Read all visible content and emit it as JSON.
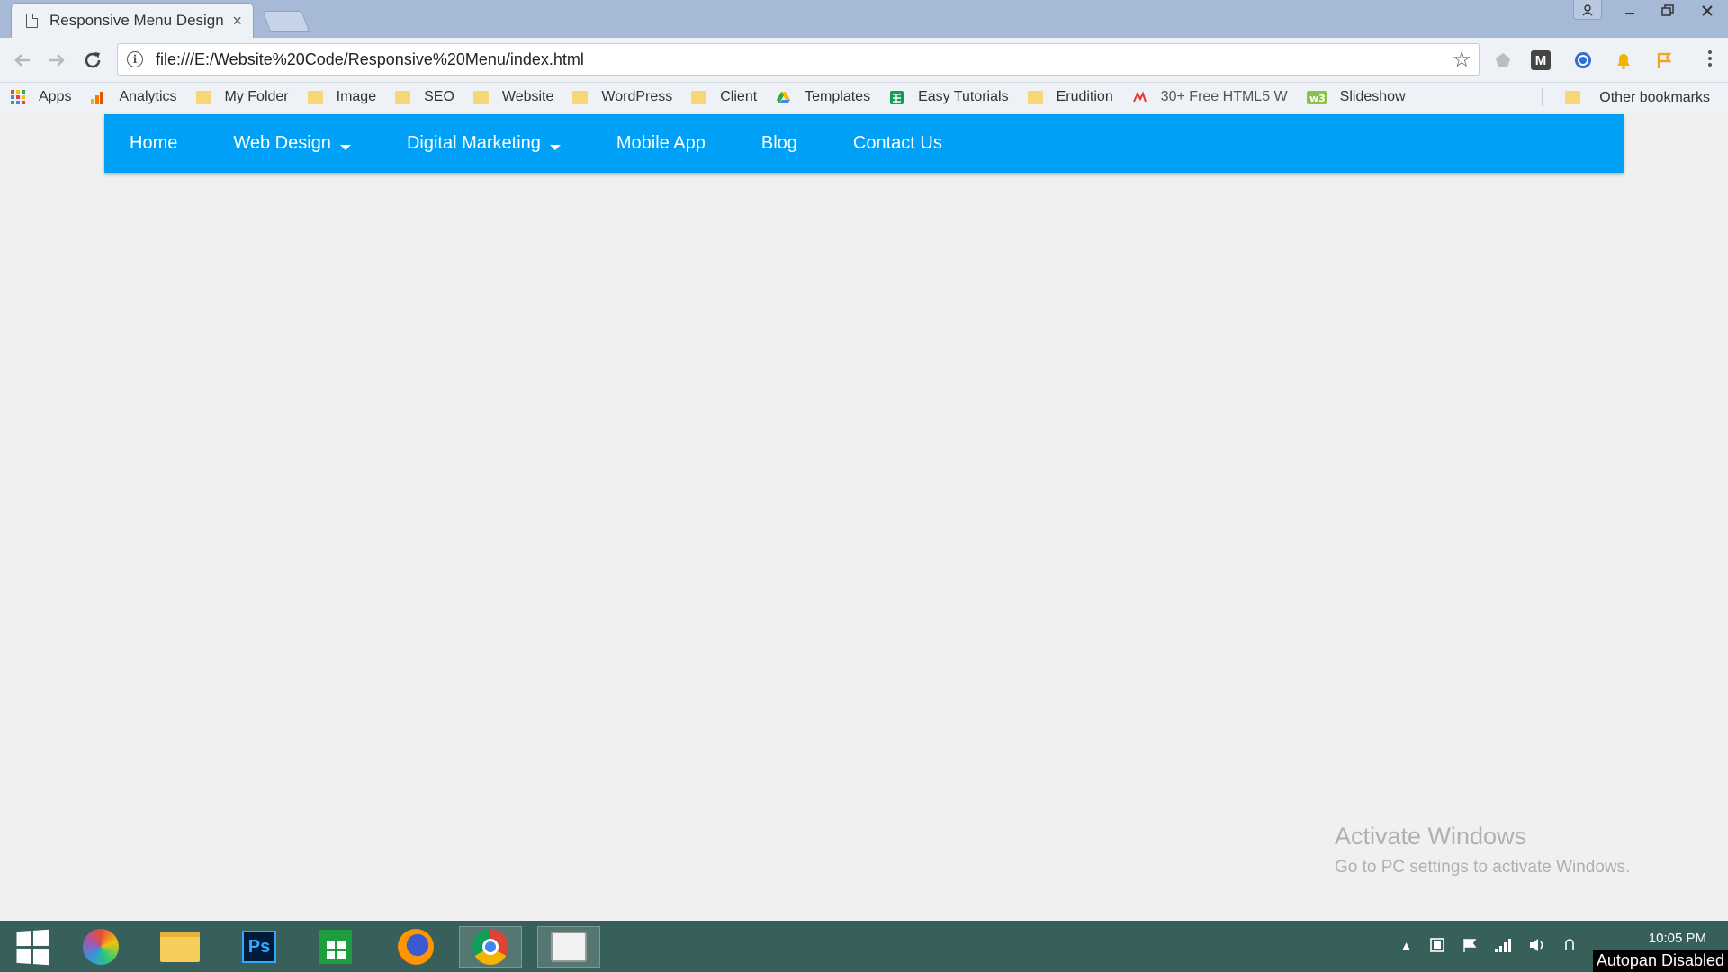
{
  "browser": {
    "tab_title": "Responsive Menu Design",
    "tab_close": "×",
    "url": "file:///E:/Website%20Code/Responsive%20Menu/index.html",
    "bookmarks": [
      {
        "label": "Apps",
        "icon": "apps-grid-icon"
      },
      {
        "label": "Analytics",
        "icon": "analytics-icon"
      },
      {
        "label": "My Folder",
        "icon": "folder-icon"
      },
      {
        "label": "Image",
        "icon": "folder-icon"
      },
      {
        "label": "SEO",
        "icon": "folder-icon"
      },
      {
        "label": "Website",
        "icon": "folder-icon"
      },
      {
        "label": "WordPress",
        "icon": "folder-icon"
      },
      {
        "label": "Client",
        "icon": "folder-icon"
      },
      {
        "label": "Templates",
        "icon": "drive-icon"
      },
      {
        "label": "Easy Tutorials",
        "icon": "sheets-icon"
      },
      {
        "label": "Erudition",
        "icon": "folder-icon"
      },
      {
        "label": "30+ Free HTML5 W",
        "icon": "html5-icon"
      },
      {
        "label": "Slideshow",
        "icon": "w3-icon"
      }
    ],
    "other_bookmarks": "Other bookmarks",
    "extensions": [
      "extension-icon",
      "gmail-icon",
      "lastpass-icon",
      "notification-icon",
      "flag-icon"
    ]
  },
  "page": {
    "nav": [
      {
        "label": "Home",
        "dropdown": false
      },
      {
        "label": "Web Design",
        "dropdown": true
      },
      {
        "label": "Digital Marketing",
        "dropdown": true
      },
      {
        "label": "Mobile App",
        "dropdown": false
      },
      {
        "label": "Blog",
        "dropdown": false
      },
      {
        "label": "Contact Us",
        "dropdown": false
      }
    ],
    "nav_color": "#00a0f7"
  },
  "watermark": {
    "line1": "Activate Windows",
    "line2": "Go to PC settings to activate Windows."
  },
  "taskbar": {
    "apps": [
      "start",
      "paint",
      "file-explorer",
      "photoshop",
      "store",
      "firefox",
      "chrome",
      "screen-recorder"
    ],
    "photoshop_label": "Ps",
    "clock": "10:05 PM",
    "autopan": "Autopan Disabled"
  }
}
